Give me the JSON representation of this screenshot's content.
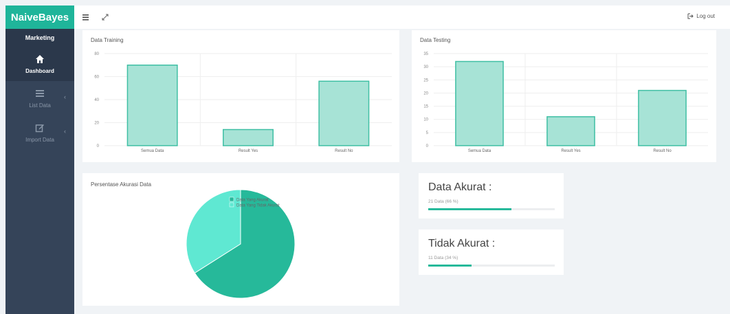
{
  "brand": {
    "title": "NaiveBayes"
  },
  "sidebar": {
    "section": "Marketing",
    "items": [
      {
        "label": "Dashboard",
        "icon": "home-icon"
      },
      {
        "label": "List Data",
        "icon": "list-icon"
      },
      {
        "label": "Import Data",
        "icon": "edit-icon"
      }
    ]
  },
  "topbar": {
    "logout_label": "Log out"
  },
  "cards": {
    "training_title": "Data Training",
    "testing_title": "Data Testing",
    "pie_title": "Persentase Akurasi Data"
  },
  "chart_data": [
    {
      "type": "bar",
      "title": "Data Training",
      "categories": [
        "Semua Data",
        "Result Yes",
        "Result No"
      ],
      "values": [
        70,
        14,
        56
      ],
      "ylim": [
        0,
        80
      ],
      "yticks": [
        0,
        20,
        40,
        60,
        80
      ],
      "grid": true,
      "color": "#a7e3d6",
      "border_color": "#3fbfa4"
    },
    {
      "type": "bar",
      "title": "Data Testing",
      "categories": [
        "Semua Data",
        "Result Yes",
        "Result No"
      ],
      "values": [
        32,
        11,
        21
      ],
      "ylim": [
        0,
        35
      ],
      "yticks": [
        0,
        5,
        10,
        15,
        20,
        25,
        30,
        35
      ],
      "grid": true,
      "color": "#a7e3d6",
      "border_color": "#3fbfa4"
    },
    {
      "type": "pie",
      "title": "Persentase Akurasi Data",
      "labels": [
        "Data Yang Akurat",
        "Data Yang Tidak Akurat"
      ],
      "values": [
        66,
        34
      ],
      "colors": [
        "#26b99a",
        "#5fe8d2"
      ],
      "legend": "top"
    }
  ],
  "stats": {
    "akurat": {
      "title": "Data Akurat :",
      "sub": "21 Data (66 %)",
      "percent": 66
    },
    "tidak": {
      "title": "Tidak Akurat :",
      "sub": "11 Data (34 %)",
      "percent": 34
    }
  }
}
